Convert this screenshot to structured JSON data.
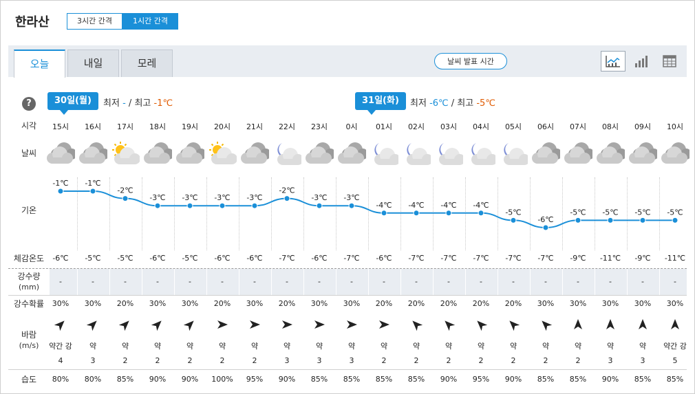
{
  "location": "한라산",
  "interval": {
    "opt3": "3시간 간격",
    "opt1": "1시간 간격"
  },
  "tabs": [
    "오늘",
    "내일",
    "모레"
  ],
  "announce": "날씨 발표 시간",
  "help": "?",
  "days": [
    {
      "label": "30일(월)",
      "min_label": "최저",
      "min": "-",
      "sep": "/",
      "max_label": "최고",
      "max": "-1℃"
    },
    {
      "label": "31일(화)",
      "min_label": "최저",
      "min": "-6℃",
      "sep": "/",
      "max_label": "최고",
      "max": "-5℃"
    }
  ],
  "row_labels": {
    "time": "시각",
    "weather": "날씨",
    "temp": "기온",
    "feels": "체감온도",
    "precip": "강수량",
    "precip_unit": "(mm)",
    "prob": "강수확률",
    "wind": "바람",
    "wind_unit": "(m/s)",
    "humidity": "습도"
  },
  "hours": [
    {
      "time": "15시",
      "icon": "cloudy",
      "temp": "-1℃",
      "temp_value": -1,
      "feels": "-6℃",
      "precip": "-",
      "prob": "30%",
      "wind_dir": "northeast",
      "wind_word": "약간 강",
      "wind_speed": "4",
      "humidity": "80%"
    },
    {
      "time": "16시",
      "icon": "cloudy",
      "temp": "-1℃",
      "temp_value": -1,
      "feels": "-5℃",
      "precip": "-",
      "prob": "30%",
      "wind_dir": "northeast",
      "wind_word": "약",
      "wind_speed": "3",
      "humidity": "80%"
    },
    {
      "time": "17시",
      "icon": "sun-cloud",
      "temp": "-2℃",
      "temp_value": -2,
      "feels": "-5℃",
      "precip": "-",
      "prob": "20%",
      "wind_dir": "northeast",
      "wind_word": "약",
      "wind_speed": "2",
      "humidity": "85%"
    },
    {
      "time": "18시",
      "icon": "cloudy",
      "temp": "-3℃",
      "temp_value": -3,
      "feels": "-6℃",
      "precip": "-",
      "prob": "30%",
      "wind_dir": "northeast",
      "wind_word": "약",
      "wind_speed": "2",
      "humidity": "90%"
    },
    {
      "time": "19시",
      "icon": "cloudy",
      "temp": "-3℃",
      "temp_value": -3,
      "feels": "-5℃",
      "precip": "-",
      "prob": "30%",
      "wind_dir": "northeast",
      "wind_word": "약",
      "wind_speed": "2",
      "humidity": "90%"
    },
    {
      "time": "20시",
      "icon": "sun-cloud",
      "temp": "-3℃",
      "temp_value": -3,
      "feels": "-6℃",
      "precip": "-",
      "prob": "20%",
      "wind_dir": "east",
      "wind_word": "약",
      "wind_speed": "2",
      "humidity": "100%"
    },
    {
      "time": "21시",
      "icon": "cloudy",
      "temp": "-3℃",
      "temp_value": -3,
      "feels": "-6℃",
      "precip": "-",
      "prob": "30%",
      "wind_dir": "east",
      "wind_word": "약",
      "wind_speed": "2",
      "humidity": "95%"
    },
    {
      "time": "22시",
      "icon": "moon-cloud",
      "temp": "-2℃",
      "temp_value": -2,
      "feels": "-7℃",
      "precip": "-",
      "prob": "20%",
      "wind_dir": "east",
      "wind_word": "약",
      "wind_speed": "3",
      "humidity": "90%"
    },
    {
      "time": "23시",
      "icon": "cloudy",
      "temp": "-3℃",
      "temp_value": -3,
      "feels": "-6℃",
      "precip": "-",
      "prob": "30%",
      "wind_dir": "east",
      "wind_word": "약",
      "wind_speed": "3",
      "humidity": "85%"
    },
    {
      "time": "0시",
      "icon": "cloudy",
      "temp": "-3℃",
      "temp_value": -3,
      "feels": "-7℃",
      "precip": "-",
      "prob": "30%",
      "wind_dir": "east",
      "wind_word": "약",
      "wind_speed": "3",
      "humidity": "85%"
    },
    {
      "time": "01시",
      "icon": "moon-cloud",
      "temp": "-4℃",
      "temp_value": -4,
      "feels": "-6℃",
      "precip": "-",
      "prob": "20%",
      "wind_dir": "east",
      "wind_word": "약",
      "wind_speed": "2",
      "humidity": "85%"
    },
    {
      "time": "02시",
      "icon": "moon-cloud",
      "temp": "-4℃",
      "temp_value": -4,
      "feels": "-7℃",
      "precip": "-",
      "prob": "20%",
      "wind_dir": "northwest",
      "wind_word": "약",
      "wind_speed": "2",
      "humidity": "85%"
    },
    {
      "time": "03시",
      "icon": "moon-cloud",
      "temp": "-4℃",
      "temp_value": -4,
      "feels": "-7℃",
      "precip": "-",
      "prob": "20%",
      "wind_dir": "northwest",
      "wind_word": "약",
      "wind_speed": "2",
      "humidity": "90%"
    },
    {
      "time": "04시",
      "icon": "moon-cloud",
      "temp": "-4℃",
      "temp_value": -4,
      "feels": "-7℃",
      "precip": "-",
      "prob": "20%",
      "wind_dir": "northwest",
      "wind_word": "약",
      "wind_speed": "2",
      "humidity": "95%"
    },
    {
      "time": "05시",
      "icon": "moon-cloud",
      "temp": "-5℃",
      "temp_value": -5,
      "feels": "-7℃",
      "precip": "-",
      "prob": "20%",
      "wind_dir": "northwest",
      "wind_word": "약",
      "wind_speed": "2",
      "humidity": "90%"
    },
    {
      "time": "06시",
      "icon": "cloudy",
      "temp": "-6℃",
      "temp_value": -6,
      "feels": "-7℃",
      "precip": "-",
      "prob": "30%",
      "wind_dir": "northwest",
      "wind_word": "약",
      "wind_speed": "2",
      "humidity": "85%"
    },
    {
      "time": "07시",
      "icon": "cloudy",
      "temp": "-5℃",
      "temp_value": -5,
      "feels": "-9℃",
      "precip": "-",
      "prob": "30%",
      "wind_dir": "north",
      "wind_word": "약",
      "wind_speed": "2",
      "humidity": "85%"
    },
    {
      "time": "08시",
      "icon": "cloudy",
      "temp": "-5℃",
      "temp_value": -5,
      "feels": "-11℃",
      "precip": "-",
      "prob": "30%",
      "wind_dir": "north",
      "wind_word": "약",
      "wind_speed": "3",
      "humidity": "90%"
    },
    {
      "time": "09시",
      "icon": "cloudy",
      "temp": "-5℃",
      "temp_value": -5,
      "feels": "-9℃",
      "precip": "-",
      "prob": "30%",
      "wind_dir": "north",
      "wind_word": "약",
      "wind_speed": "3",
      "humidity": "85%"
    },
    {
      "time": "10시",
      "icon": "cloudy",
      "temp": "-5℃",
      "temp_value": -5,
      "feels": "-11℃",
      "precip": "-",
      "prob": "30%",
      "wind_dir": "north",
      "wind_word": "약간 강",
      "wind_speed": "5",
      "humidity": "85%"
    }
  ],
  "colors": {
    "accent": "#1a8fd8",
    "cold": "#1a8fd8",
    "warm": "#e05a00",
    "line": "#1a8fd8"
  }
}
